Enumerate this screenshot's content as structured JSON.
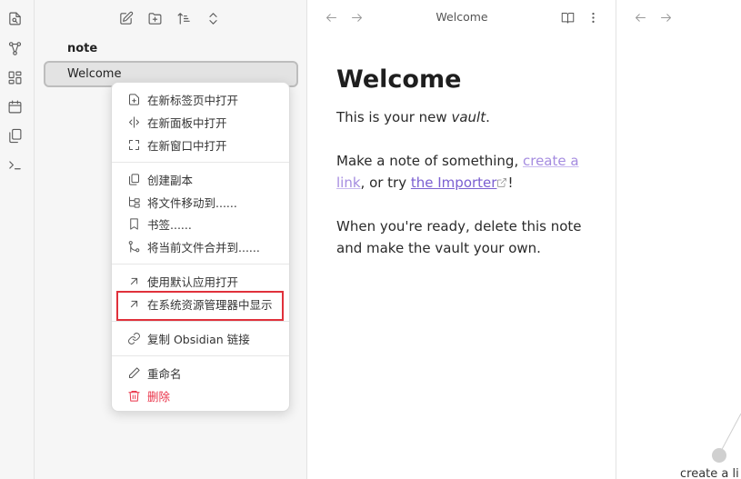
{
  "ribbon": {
    "icons": [
      "open-switcher-icon",
      "graph-icon",
      "canvas-icon",
      "daily-note-icon",
      "templates-icon",
      "command-palette-icon"
    ]
  },
  "explorer": {
    "nav_icons": [
      "new-note-icon",
      "new-folder-icon",
      "sort-icon",
      "collapse-icon"
    ],
    "folder_name": "note",
    "active_file": "Welcome"
  },
  "context_menu": {
    "groups": [
      [
        "在新标签页中打开",
        "在新面板中打开",
        "在新窗口中打开"
      ],
      [
        "创建副本",
        "将文件移动到......",
        "书签......",
        "将当前文件合并到......"
      ],
      [
        "使用默认应用打开",
        "在系统资源管理器中显示"
      ],
      [
        "复制 Obsidian 链接"
      ],
      [
        "重命名",
        "删除"
      ]
    ],
    "highlighted_item": "在系统资源管理器中显示"
  },
  "editor": {
    "title": "Welcome",
    "heading": "Welcome",
    "p1_before": "This is your new ",
    "p1_em": "vault",
    "p1_after": ".",
    "p2_before": "Make a note of something, ",
    "p2_link": "create a link",
    "p2_mid": ", or try ",
    "p2_ext": "the Importer",
    "p2_after": "!",
    "p3": "When you're ready, delete this note and make the vault your own."
  },
  "graph": {
    "node_label": "create a li"
  },
  "colors": {
    "accent": "#7b5fd1",
    "danger": "#e93147",
    "highlight_box": "#e0313b"
  }
}
